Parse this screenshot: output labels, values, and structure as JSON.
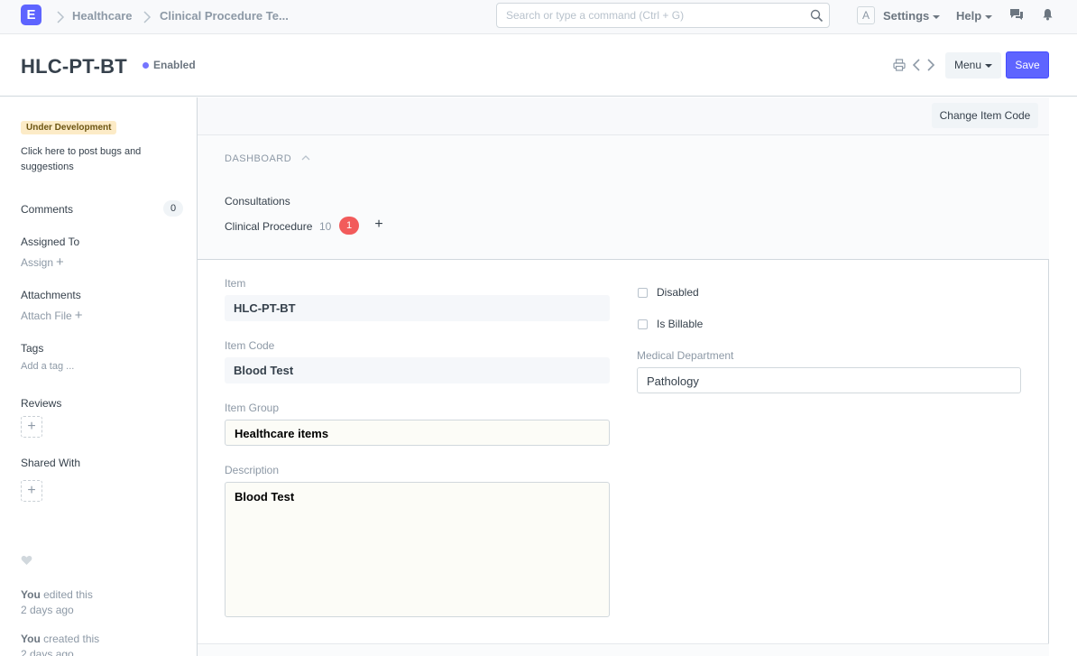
{
  "navbar": {
    "logo": "E",
    "breadcrumbs": [
      "Healthcare",
      "Clinical Procedure Te..."
    ],
    "search_placeholder": "Search or type a command (Ctrl + G)",
    "avatar": "A",
    "settings": "Settings",
    "help": "Help"
  },
  "page": {
    "title": "HLC-PT-BT",
    "status": "Enabled",
    "menu_label": "Menu",
    "save_label": "Save"
  },
  "sidebar": {
    "dev_badge": "Under Development",
    "dev_text": "Click here to post bugs and suggestions",
    "comments_label": "Comments",
    "comments_count": "0",
    "assigned_label": "Assigned To",
    "assign_action": "Assign",
    "attachments_label": "Attachments",
    "attach_action": "Attach File",
    "tags_label": "Tags",
    "tags_action": "Add a tag ...",
    "reviews_label": "Reviews",
    "shared_label": "Shared With",
    "timeline": [
      {
        "who": "You",
        "action": "edited this",
        "when": "2 days ago"
      },
      {
        "who": "You",
        "action": "created this",
        "when": "2 days ago"
      }
    ]
  },
  "toolbar": {
    "change_item_code": "Change Item Code"
  },
  "dashboard": {
    "heading": "DASHBOARD",
    "section": "Consultations",
    "link_label": "Clinical Procedure",
    "link_count": "10",
    "badge": "1"
  },
  "form": {
    "item_label": "Item",
    "item_value": "HLC-PT-BT",
    "item_code_label": "Item Code",
    "item_code_value": "Blood Test",
    "item_group_label": "Item Group",
    "item_group_value": "Healthcare items",
    "description_label": "Description",
    "description_value": "Blood Test",
    "disabled_label": "Disabled",
    "billable_label": "Is Billable",
    "department_label": "Medical Department",
    "department_value": "Pathology"
  }
}
